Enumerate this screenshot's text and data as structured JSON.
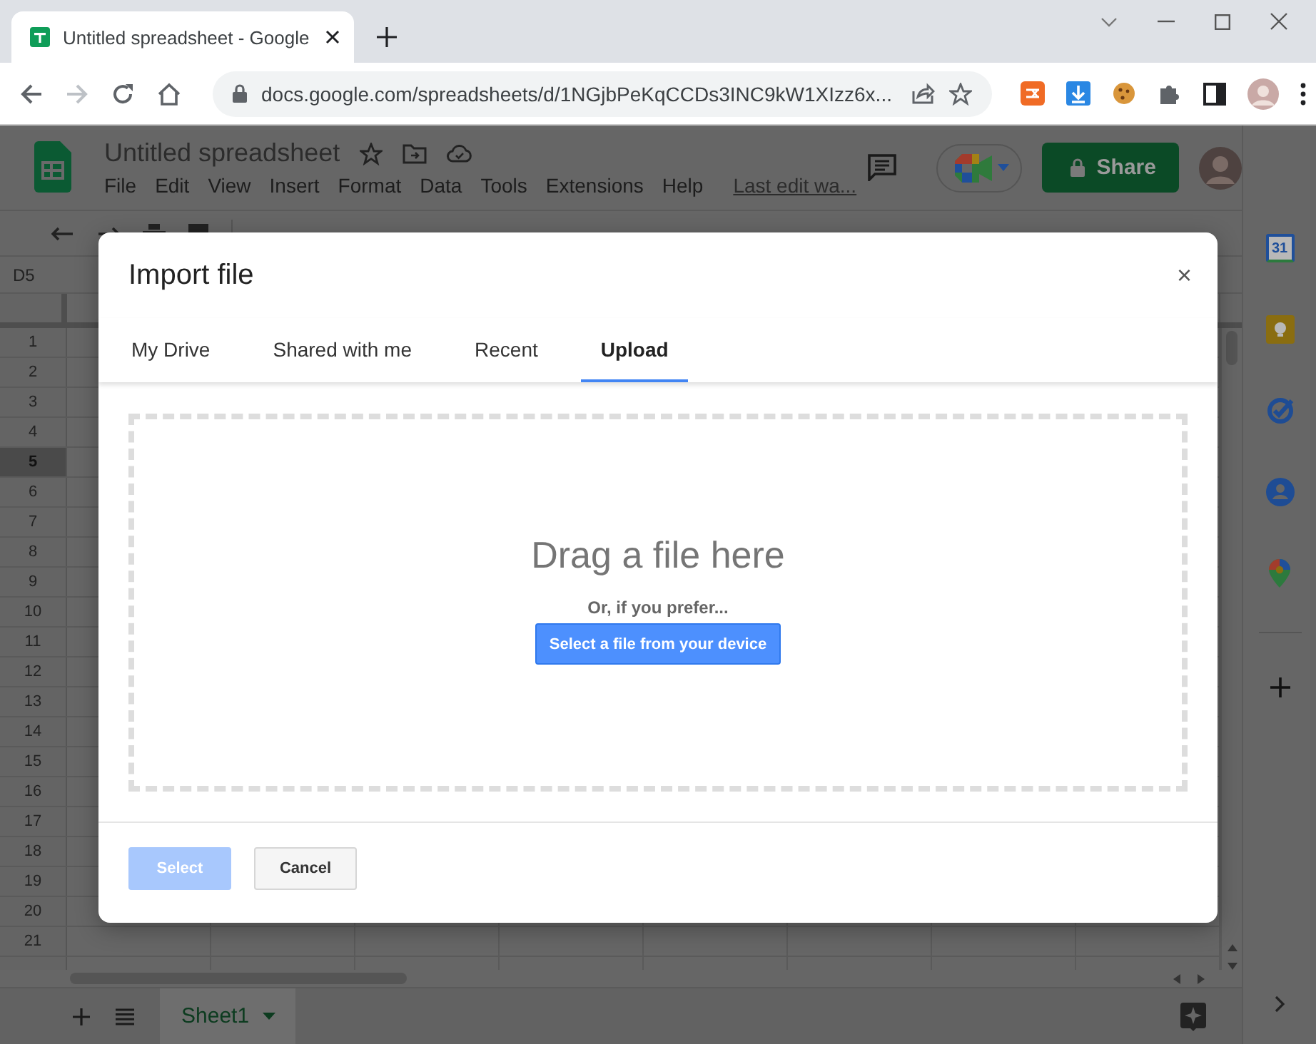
{
  "browser": {
    "tab": {
      "title": "Untitled spreadsheet - Google",
      "selected": true
    },
    "address": "docs.google.com/spreadsheets/d/1NGjbPeKqCCDs3INC9kW1XIzz6x..."
  },
  "sheets": {
    "title": "Untitled spreadsheet",
    "menu": [
      "File",
      "Edit",
      "View",
      "Insert",
      "Format",
      "Data",
      "Tools",
      "Extensions",
      "Help"
    ],
    "last_edit": "Last edit wa...",
    "share": "Share",
    "name_box": "D5",
    "rows": [
      {
        "label": "1",
        "selected": false
      },
      {
        "label": "2",
        "selected": false
      },
      {
        "label": "3",
        "selected": false
      },
      {
        "label": "4",
        "selected": false
      },
      {
        "label": "5",
        "selected": true
      },
      {
        "label": "6",
        "selected": false
      },
      {
        "label": "7",
        "selected": false
      },
      {
        "label": "8",
        "selected": false
      },
      {
        "label": "9",
        "selected": false
      },
      {
        "label": "10",
        "selected": false
      },
      {
        "label": "11",
        "selected": false
      },
      {
        "label": "12",
        "selected": false
      },
      {
        "label": "13",
        "selected": false
      },
      {
        "label": "14",
        "selected": false
      },
      {
        "label": "15",
        "selected": false
      },
      {
        "label": "16",
        "selected": false
      },
      {
        "label": "17",
        "selected": false
      },
      {
        "label": "18",
        "selected": false
      },
      {
        "label": "19",
        "selected": false
      },
      {
        "label": "20",
        "selected": false
      },
      {
        "label": "21",
        "selected": false
      }
    ],
    "sheet_tabs": [
      {
        "label": "Sheet1",
        "selected": true
      }
    ],
    "side_panel": {
      "calendar_day": "31"
    }
  },
  "dialog": {
    "title": "Import file",
    "close": "×",
    "tabs": [
      {
        "label": "My Drive",
        "selected": false
      },
      {
        "label": "Shared with me",
        "selected": false
      },
      {
        "label": "Recent",
        "selected": false
      },
      {
        "label": "Upload",
        "selected": true
      }
    ],
    "drop_title": "Drag a file here",
    "drop_hint": "Or, if you prefer...",
    "device_button": "Select a file from your device",
    "buttons": [
      {
        "label": "Select",
        "kind": "primary",
        "disabled": true
      },
      {
        "label": "Cancel",
        "kind": "secondary",
        "disabled": false
      }
    ]
  }
}
